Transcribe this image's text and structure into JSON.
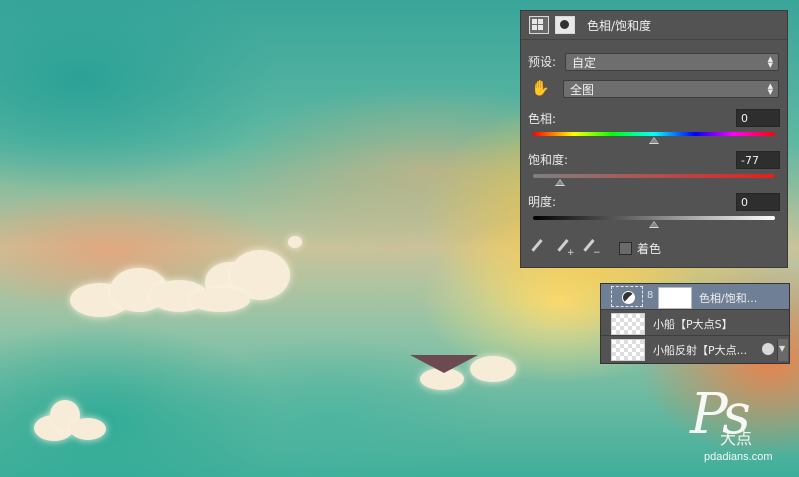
{
  "properties_panel": {
    "title": "色相/饱和度",
    "preset_label": "预设:",
    "preset_value": "自定",
    "channel_value": "全图",
    "hue_label": "色相:",
    "hue_value": "0",
    "saturation_label": "饱和度:",
    "saturation_value": "-77",
    "lightness_label": "明度:",
    "lightness_value": "0",
    "colorize_label": "着色",
    "colorize_checked": false
  },
  "layers_panel": {
    "layers": [
      {
        "name": "色相/饱和...",
        "type": "adjustment",
        "selected": true
      },
      {
        "name": "小船【P大点S】",
        "type": "pixel",
        "selected": false
      },
      {
        "name": "小船反射【P大点...",
        "type": "smart",
        "selected": false
      }
    ]
  },
  "watermark": {
    "text": "Ps",
    "sub": "大点",
    "site": "pdadians.com"
  },
  "colors": {
    "panel_bg": "#535353",
    "selected_layer": "#6f7f96"
  }
}
